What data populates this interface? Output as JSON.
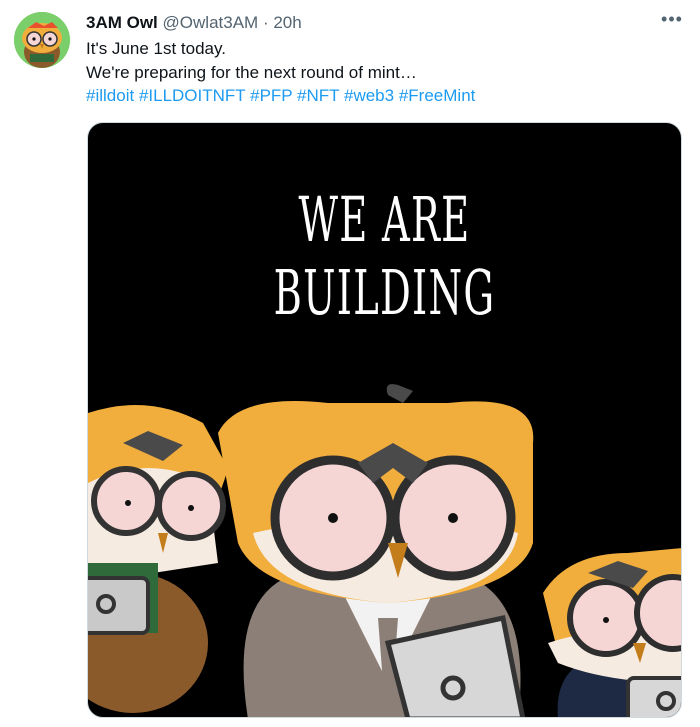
{
  "author": {
    "name": "3AM Owl",
    "handle": "@Owlat3AM",
    "separator": "·",
    "time": "20h"
  },
  "more_icon": "more-horizontal-icon",
  "tweet": {
    "lines": [
      "It's June 1st today.",
      "We're preparing for the next round of mint…"
    ],
    "hashtags": [
      "#illdoit",
      "#ILLDOITNFT",
      "#PFP",
      "#NFT",
      "#web3",
      "#FreeMint"
    ]
  },
  "media": {
    "title": "WE ARE BUILDING"
  },
  "colors": {
    "link": "#1d9bf0",
    "secondary_text": "#536471",
    "owl_orange": "#f2ae3d",
    "media_bg": "#000000"
  }
}
